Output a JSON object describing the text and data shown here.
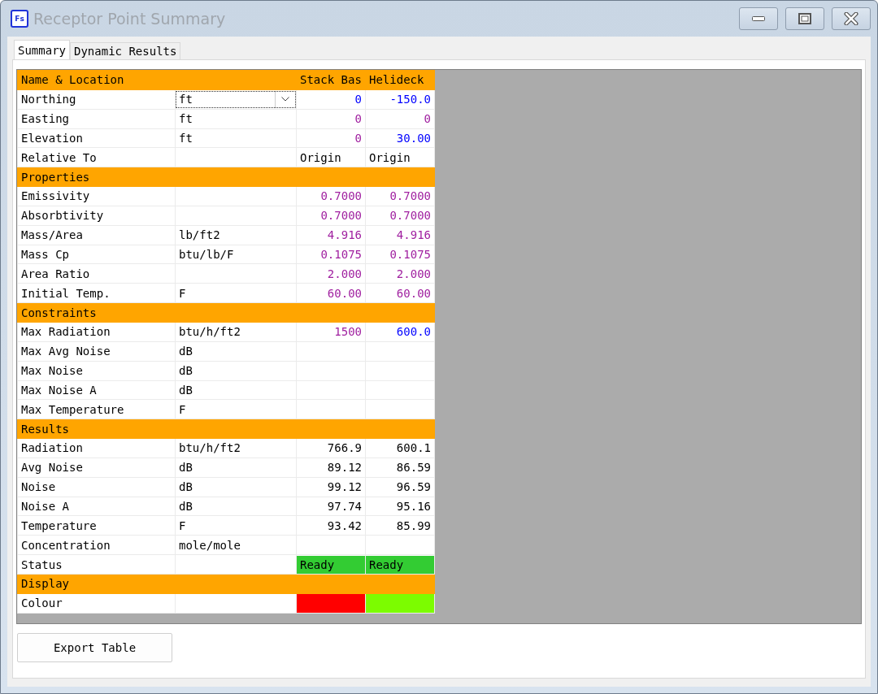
{
  "window": {
    "title": "Receptor Point Summary",
    "app_icon_text": "Fs"
  },
  "tabs": [
    {
      "label": "Summary",
      "selected": true
    },
    {
      "label": "Dynamic Results",
      "selected": false
    }
  ],
  "table": {
    "sections": [
      {
        "title": "Name & Location",
        "columns": [
          "Stack Bas",
          "Helideck"
        ],
        "rows": [
          {
            "label": "Northing",
            "unit": {
              "kind": "dropdown",
              "text": "ft"
            },
            "cells": [
              {
                "kind": "number",
                "text": "0",
                "color": "#0000ff"
              },
              {
                "kind": "number",
                "text": "-150.0",
                "color": "#0000ff"
              }
            ]
          },
          {
            "label": "Easting",
            "unit": {
              "kind": "text",
              "text": "ft"
            },
            "cells": [
              {
                "kind": "number",
                "text": "0",
                "color": "#a020a0"
              },
              {
                "kind": "number",
                "text": "0",
                "color": "#a020a0"
              }
            ]
          },
          {
            "label": "Elevation",
            "unit": {
              "kind": "text",
              "text": "ft"
            },
            "cells": [
              {
                "kind": "number",
                "text": "0",
                "color": "#a020a0"
              },
              {
                "kind": "number",
                "text": "30.00",
                "color": "#0000ff"
              }
            ]
          },
          {
            "label": "Relative To",
            "unit": {
              "kind": "empty"
            },
            "cells": [
              {
                "kind": "text",
                "text": "Origin",
                "color": "#000000"
              },
              {
                "kind": "text",
                "text": "Origin",
                "color": "#000000"
              }
            ]
          }
        ]
      },
      {
        "title": "Properties",
        "rows": [
          {
            "label": "Emissivity",
            "unit": {
              "kind": "empty"
            },
            "cells": [
              {
                "kind": "number",
                "text": "0.7000",
                "color": "#a020a0"
              },
              {
                "kind": "number",
                "text": "0.7000",
                "color": "#a020a0"
              }
            ]
          },
          {
            "label": "Absorbtivity",
            "unit": {
              "kind": "empty"
            },
            "cells": [
              {
                "kind": "number",
                "text": "0.7000",
                "color": "#a020a0"
              },
              {
                "kind": "number",
                "text": "0.7000",
                "color": "#a020a0"
              }
            ]
          },
          {
            "label": "Mass/Area",
            "unit": {
              "kind": "text",
              "text": "lb/ft2"
            },
            "cells": [
              {
                "kind": "number",
                "text": "4.916",
                "color": "#a020a0"
              },
              {
                "kind": "number",
                "text": "4.916",
                "color": "#a020a0"
              }
            ]
          },
          {
            "label": "Mass Cp",
            "unit": {
              "kind": "text",
              "text": "btu/lb/F"
            },
            "cells": [
              {
                "kind": "number",
                "text": "0.1075",
                "color": "#a020a0"
              },
              {
                "kind": "number",
                "text": "0.1075",
                "color": "#a020a0"
              }
            ]
          },
          {
            "label": "Area Ratio",
            "unit": {
              "kind": "empty"
            },
            "cells": [
              {
                "kind": "number",
                "text": "2.000",
                "color": "#a020a0"
              },
              {
                "kind": "number",
                "text": "2.000",
                "color": "#a020a0"
              }
            ]
          },
          {
            "label": "Initial Temp.",
            "unit": {
              "kind": "text",
              "text": "F"
            },
            "cells": [
              {
                "kind": "number",
                "text": "60.00",
                "color": "#a020a0"
              },
              {
                "kind": "number",
                "text": "60.00",
                "color": "#a020a0"
              }
            ]
          }
        ]
      },
      {
        "title": "Constraints",
        "rows": [
          {
            "label": "Max Radiation",
            "unit": {
              "kind": "text",
              "text": "btu/h/ft2"
            },
            "cells": [
              {
                "kind": "number",
                "text": "1500",
                "color": "#a020a0"
              },
              {
                "kind": "number",
                "text": "600.0",
                "color": "#0000ff"
              }
            ]
          },
          {
            "label": "Max Avg Noise",
            "unit": {
              "kind": "text",
              "text": "dB"
            },
            "cells": [
              {
                "kind": "empty"
              },
              {
                "kind": "empty"
              }
            ]
          },
          {
            "label": "Max Noise",
            "unit": {
              "kind": "text",
              "text": "dB"
            },
            "cells": [
              {
                "kind": "empty"
              },
              {
                "kind": "empty"
              }
            ]
          },
          {
            "label": "Max Noise A",
            "unit": {
              "kind": "text",
              "text": "dB"
            },
            "cells": [
              {
                "kind": "empty"
              },
              {
                "kind": "empty"
              }
            ]
          },
          {
            "label": "Max Temperature",
            "unit": {
              "kind": "text",
              "text": "F"
            },
            "cells": [
              {
                "kind": "empty"
              },
              {
                "kind": "empty"
              }
            ]
          }
        ]
      },
      {
        "title": "Results",
        "rows": [
          {
            "label": "Radiation",
            "unit": {
              "kind": "text",
              "text": "btu/h/ft2"
            },
            "cells": [
              {
                "kind": "number",
                "text": "766.9",
                "color": "#000000"
              },
              {
                "kind": "number",
                "text": "600.1",
                "color": "#000000"
              }
            ]
          },
          {
            "label": "Avg Noise",
            "unit": {
              "kind": "text",
              "text": "dB"
            },
            "cells": [
              {
                "kind": "number",
                "text": "89.12",
                "color": "#000000"
              },
              {
                "kind": "number",
                "text": "86.59",
                "color": "#000000"
              }
            ]
          },
          {
            "label": "Noise",
            "unit": {
              "kind": "text",
              "text": "dB"
            },
            "cells": [
              {
                "kind": "number",
                "text": "99.12",
                "color": "#000000"
              },
              {
                "kind": "number",
                "text": "96.59",
                "color": "#000000"
              }
            ]
          },
          {
            "label": "Noise A",
            "unit": {
              "kind": "text",
              "text": "dB"
            },
            "cells": [
              {
                "kind": "number",
                "text": "97.74",
                "color": "#000000"
              },
              {
                "kind": "number",
                "text": "95.16",
                "color": "#000000"
              }
            ]
          },
          {
            "label": "Temperature",
            "unit": {
              "kind": "text",
              "text": "F"
            },
            "cells": [
              {
                "kind": "number",
                "text": "93.42",
                "color": "#000000"
              },
              {
                "kind": "number",
                "text": "85.99",
                "color": "#000000"
              }
            ]
          },
          {
            "label": "Concentration",
            "unit": {
              "kind": "text",
              "text": "mole/mole"
            },
            "cells": [
              {
                "kind": "empty"
              },
              {
                "kind": "empty"
              }
            ]
          },
          {
            "label": "Status",
            "unit": {
              "kind": "empty"
            },
            "cells": [
              {
                "kind": "status",
                "text": "Ready",
                "color": "#33cc33"
              },
              {
                "kind": "status",
                "text": "Ready",
                "color": "#33cc33"
              }
            ]
          }
        ]
      },
      {
        "title": "Display",
        "rows": [
          {
            "label": "Colour",
            "unit": {
              "kind": "empty"
            },
            "cells": [
              {
                "kind": "swatch",
                "color": "#ff0000"
              },
              {
                "kind": "swatch",
                "color": "#7cfc00"
              }
            ]
          }
        ]
      }
    ]
  },
  "buttons": [
    {
      "label": "Export Table"
    }
  ]
}
